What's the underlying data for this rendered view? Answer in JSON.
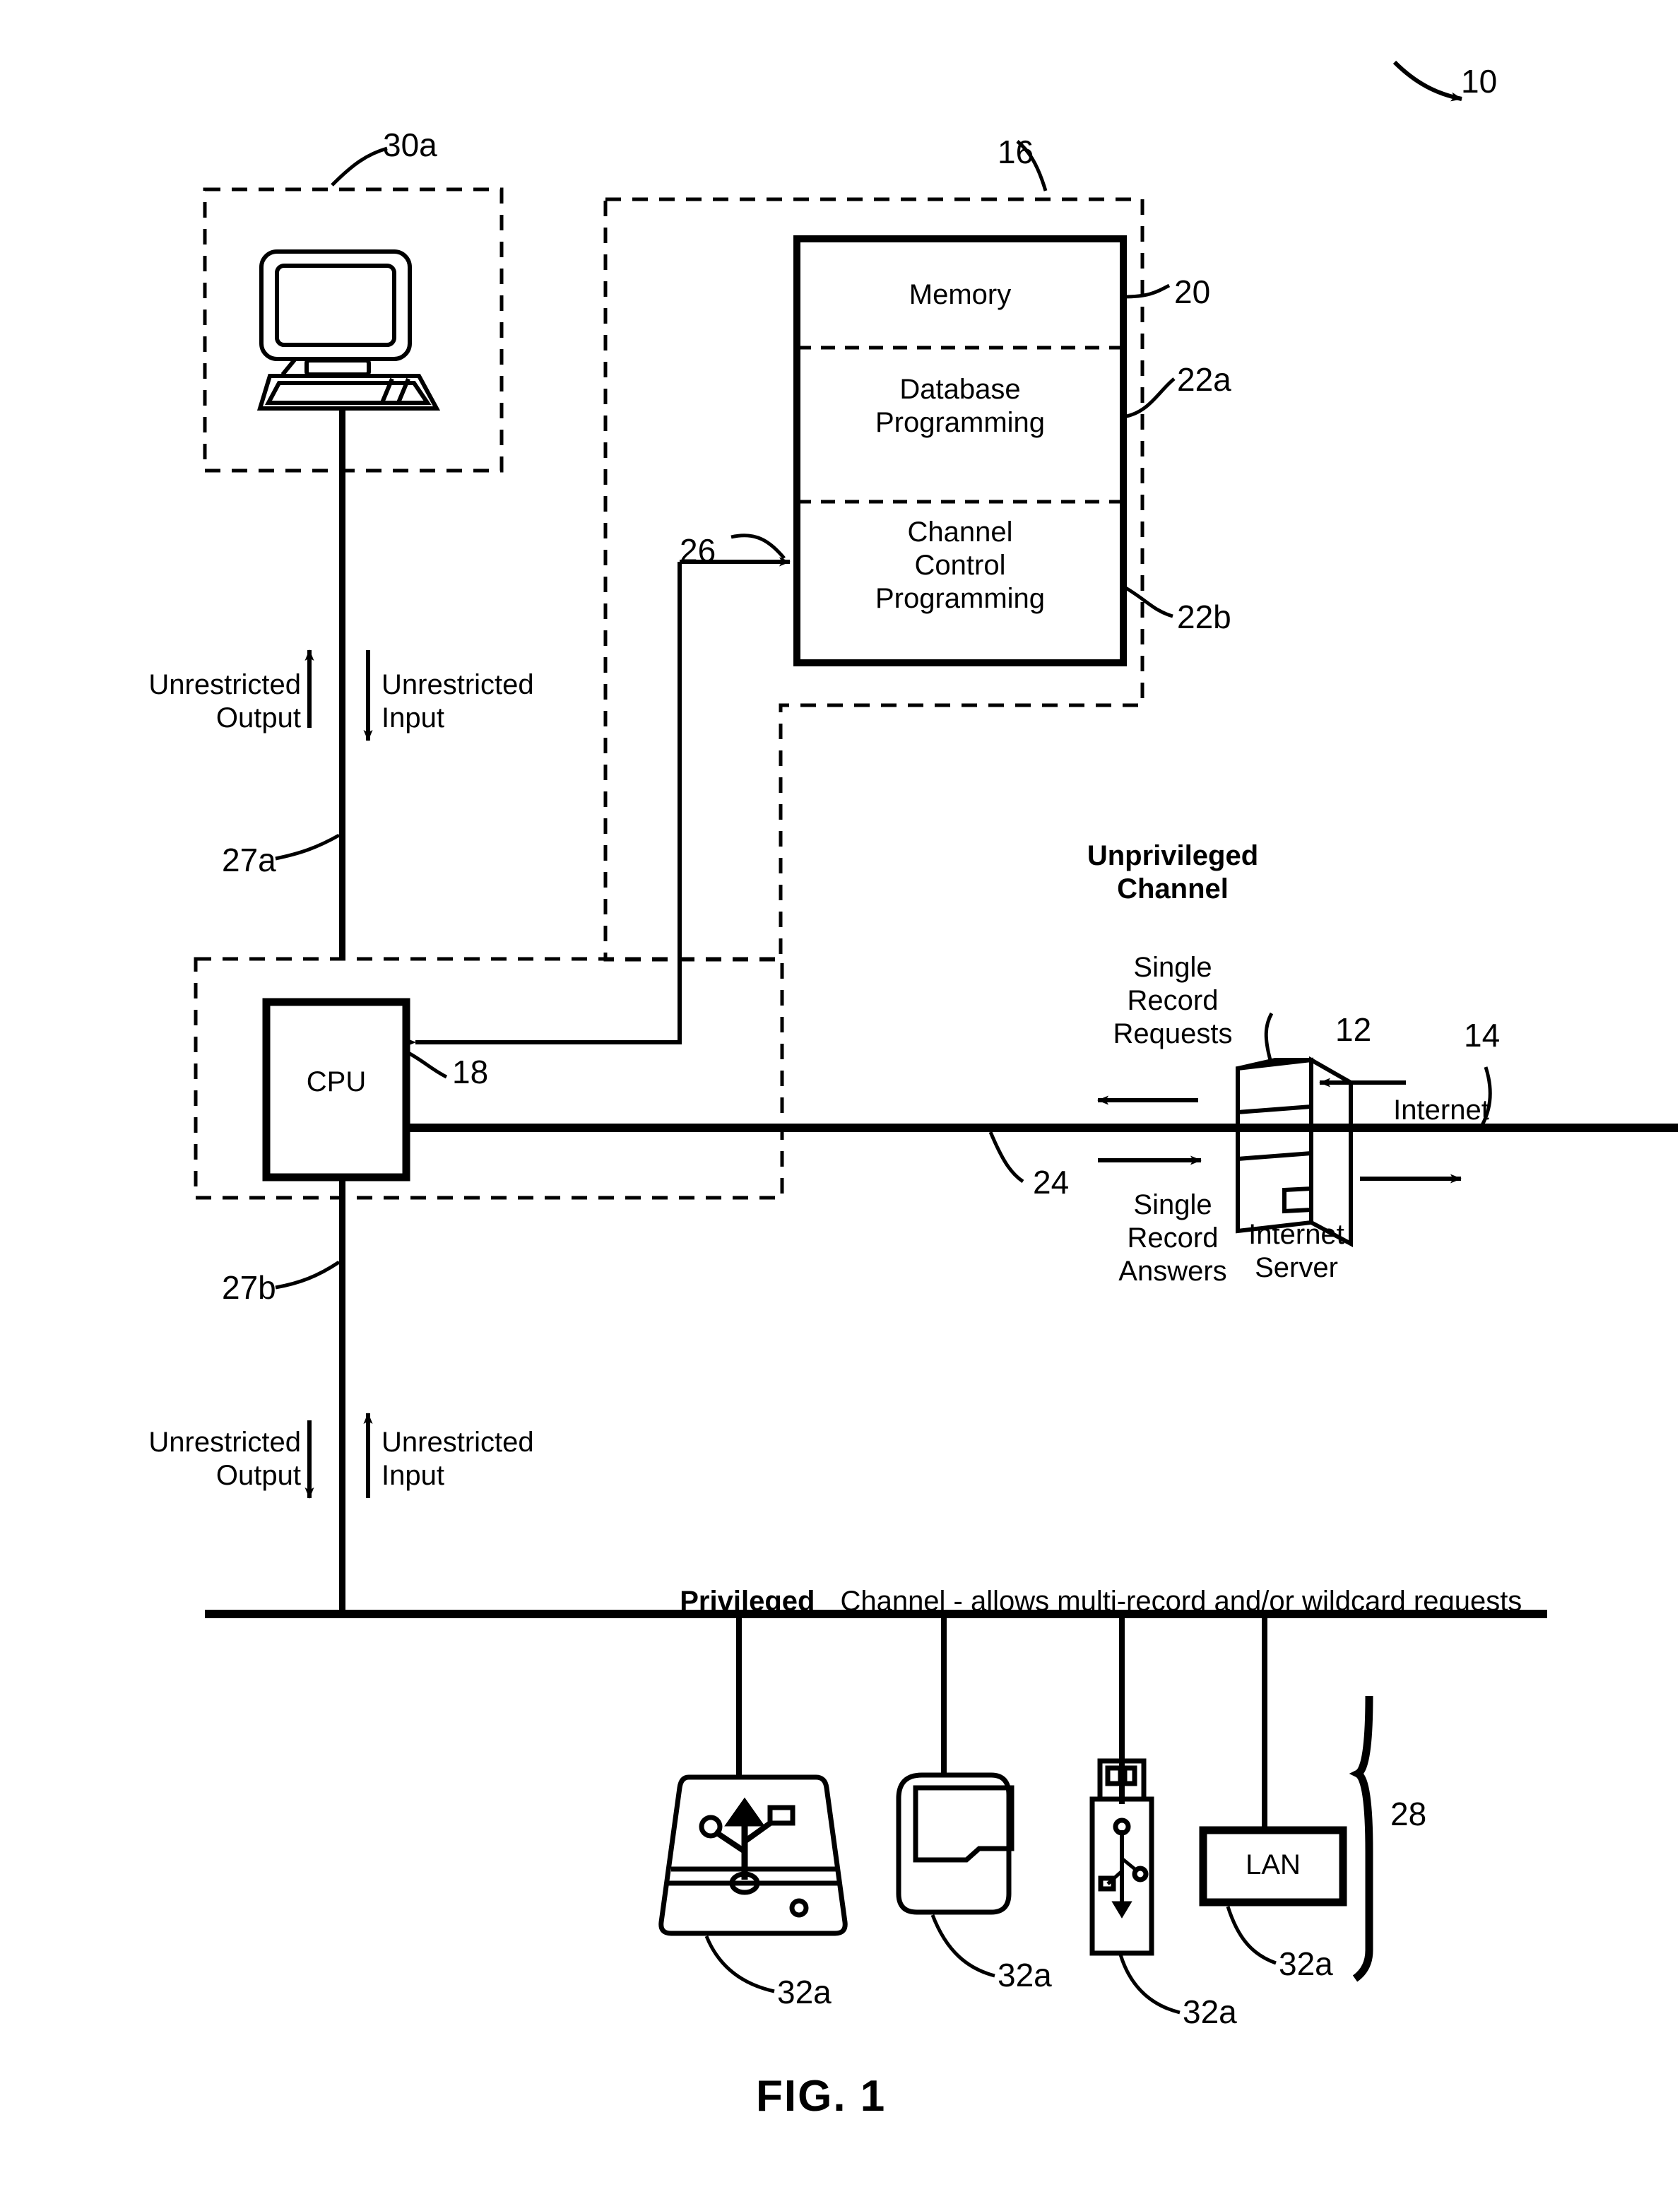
{
  "figure": {
    "caption": "FIG. 1",
    "system_ref": "10"
  },
  "refs": {
    "system": "10",
    "computer_unit": "30a",
    "memory_unit": "16",
    "memory": "20",
    "database_programming": "22a",
    "channel_control_programming": "22b",
    "memory_bus": "26",
    "cpu_bus": "18",
    "unrestricted_channel_a": "27a",
    "unrestricted_channel_b": "27b",
    "unprivileged_channel": "24",
    "internet_server": "12",
    "internet": "14",
    "peripheral_group": "28",
    "peripheral_a": "32a",
    "peripheral_b": "32a",
    "peripheral_c": "32a",
    "peripheral_d": "32a"
  },
  "memory_block": {
    "rows": [
      {
        "label": "Memory",
        "ref": "20"
      },
      {
        "label": "Database\nProgramming",
        "ref": "22a"
      },
      {
        "label": "Channel\nControl\nProgramming",
        "ref": "22b"
      }
    ]
  },
  "cpu": {
    "label": "CPU"
  },
  "top_flow": {
    "output_label": "Unrestricted\nOutput",
    "input_label": "Unrestricted\nInput"
  },
  "bottom_flow": {
    "output_label": "Unrestricted\nOutput",
    "input_label": "Unrestricted\nInput"
  },
  "unprivileged": {
    "title": "Unprivileged\nChannel",
    "requests": "Single\nRecord\nRequests",
    "answers": "Single\nRecord\nAnswers",
    "server_label": "Internet\nServer",
    "internet_label": "Internet"
  },
  "privileged": {
    "title_bold": "Privileged",
    "title_rest": "Channel - allows multi-record and/or wildcard requests"
  },
  "peripherals": [
    {
      "name": "external-usb-drive",
      "label": "",
      "ref": "32a"
    },
    {
      "name": "camera-device",
      "label": "",
      "ref": "32a"
    },
    {
      "name": "usb-flash-drive",
      "label": "",
      "ref": "32a"
    },
    {
      "name": "lan-box",
      "label": "LAN",
      "ref": "32a"
    }
  ],
  "colors": {
    "ink": "#000000",
    "paper": "#ffffff"
  }
}
